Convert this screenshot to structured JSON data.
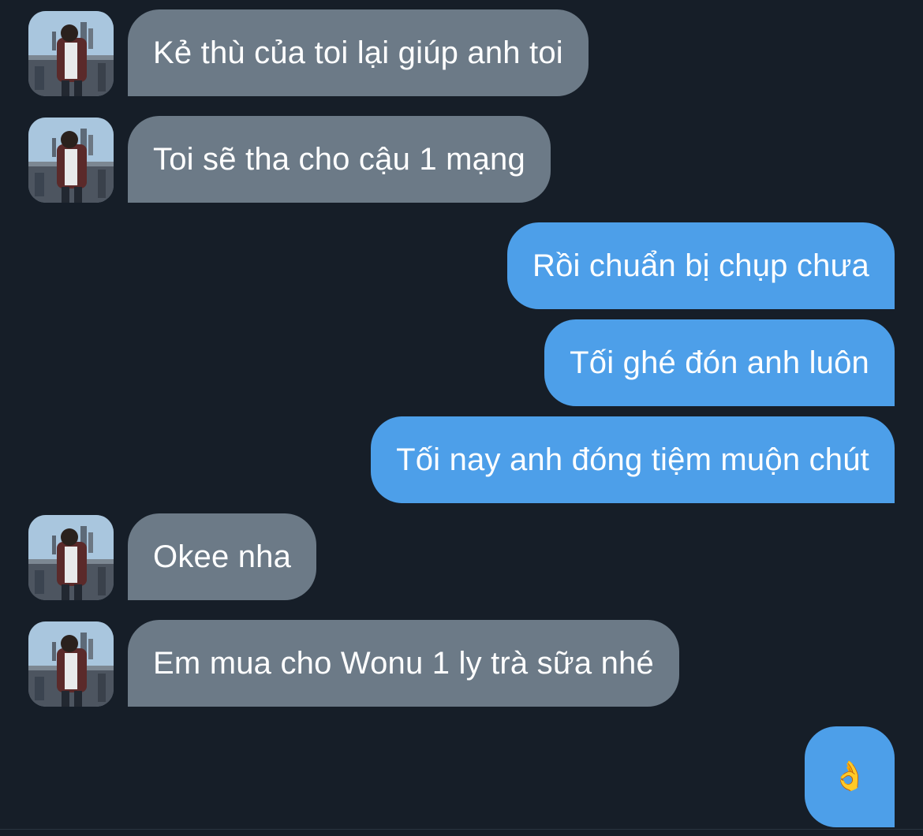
{
  "messages": [
    {
      "side": "in",
      "text": "Kẻ thù của toi lại giúp anh toi"
    },
    {
      "side": "in",
      "text": "Toi sẽ tha cho cậu 1 mạng"
    },
    {
      "side": "out",
      "text": "Rồi chuẩn bị chụp chưa"
    },
    {
      "side": "out",
      "text": "Tối ghé đón anh luôn"
    },
    {
      "side": "out",
      "text": "Tối nay anh đóng tiệm muộn chút"
    },
    {
      "side": "in",
      "text": "Okee nha"
    },
    {
      "side": "in",
      "text": "Em mua cho Wonu 1 ly trà sữa nhé"
    },
    {
      "side": "out",
      "text": "👌",
      "emoji_name": "ok-hand-emoji"
    }
  ],
  "colors": {
    "background": "#161e28",
    "incoming_bubble": "#6c7a87",
    "outgoing_bubble": "#4d9fe9",
    "text": "#ffffff"
  }
}
